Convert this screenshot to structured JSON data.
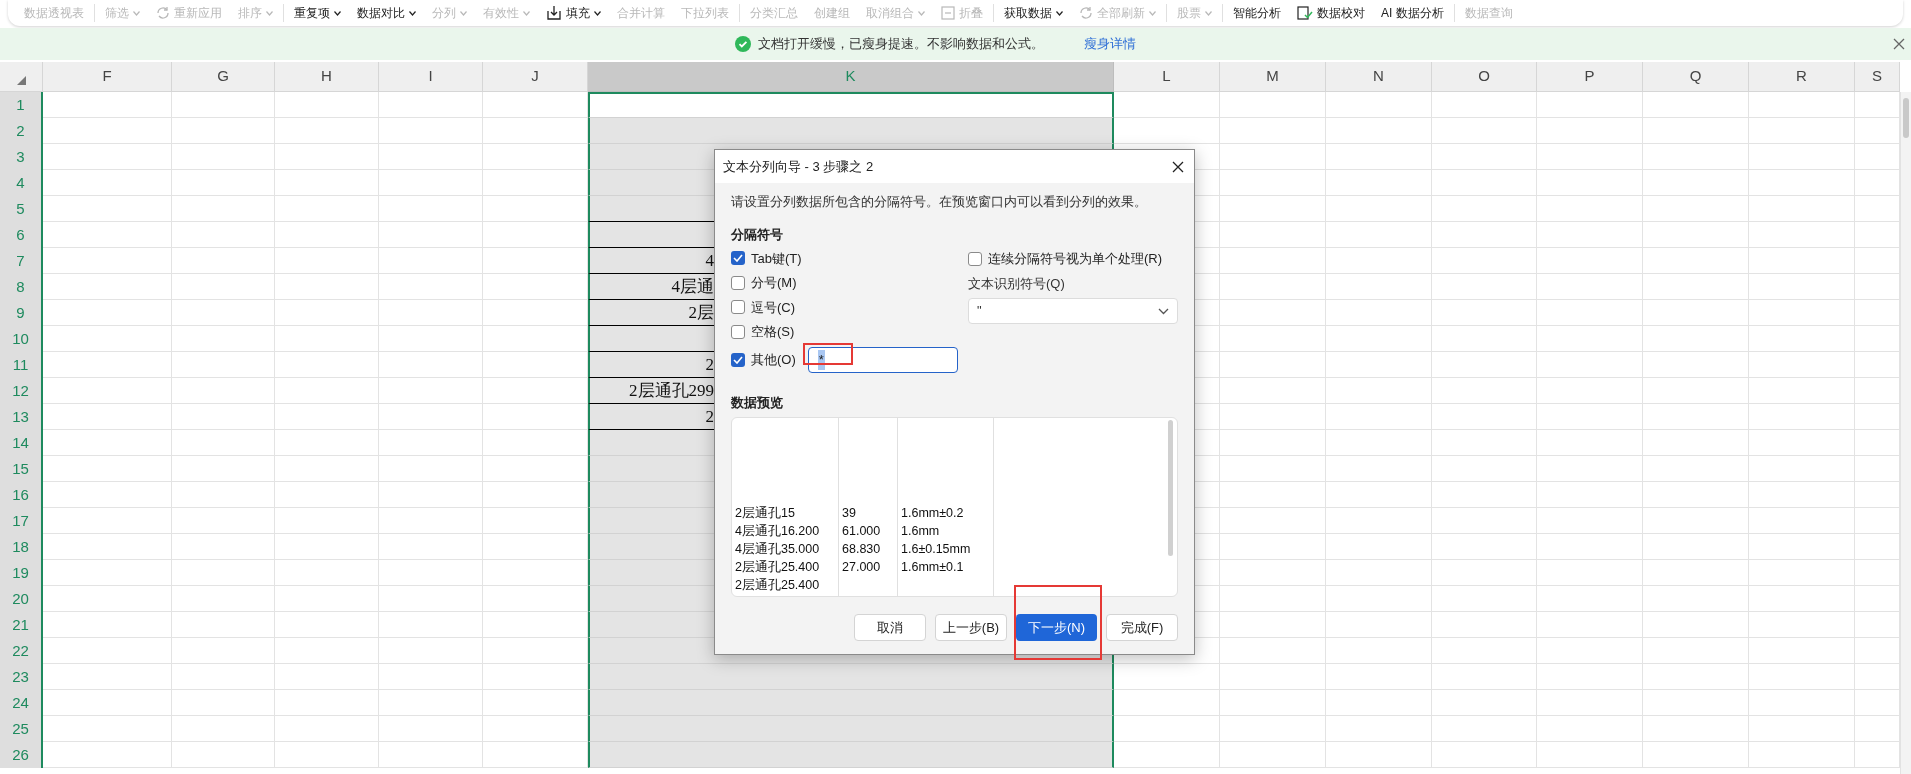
{
  "toolbar": {
    "groups": [
      {
        "items": [
          {
            "label": "数据透视表",
            "disabled": true,
            "dropdown": false
          }
        ]
      },
      {
        "items": [
          {
            "label": "筛选",
            "disabled": true,
            "dropdown": true
          },
          {
            "label": "重新应用",
            "disabled": true,
            "dropdown": false,
            "kind": "refresh"
          },
          {
            "label": "排序",
            "disabled": true,
            "dropdown": true
          }
        ]
      },
      {
        "items": [
          {
            "label": "重复项",
            "disabled": false,
            "dropdown": true
          },
          {
            "label": "数据对比",
            "disabled": false,
            "dropdown": true
          },
          {
            "label": "分列",
            "disabled": true,
            "dropdown": true
          },
          {
            "label": "有效性",
            "disabled": true,
            "dropdown": true
          },
          {
            "label": "填充",
            "disabled": false,
            "dropdown": true,
            "kind": "download"
          },
          {
            "label": "合并计算",
            "disabled": true,
            "dropdown": false
          },
          {
            "label": "下拉列表",
            "disabled": true,
            "dropdown": false
          }
        ]
      },
      {
        "items": [
          {
            "label": "分类汇总",
            "disabled": true,
            "dropdown": false
          },
          {
            "label": "创建组",
            "disabled": true,
            "dropdown": false
          },
          {
            "label": "取消组合",
            "disabled": true,
            "dropdown": true
          },
          {
            "label": "折叠",
            "disabled": true,
            "dropdown": false,
            "kind": "collapse"
          }
        ]
      },
      {
        "items": [
          {
            "label": "获取数据",
            "disabled": false,
            "dropdown": true
          },
          {
            "label": "全部刷新",
            "disabled": true,
            "dropdown": true,
            "kind": "refresh"
          }
        ]
      },
      {
        "items": [
          {
            "label": "股票",
            "disabled": true,
            "dropdown": true
          }
        ]
      },
      {
        "items": [
          {
            "label": "智能分析",
            "disabled": false,
            "dropdown": false
          },
          {
            "label": "数据校对",
            "disabled": false,
            "dropdown": false,
            "kind": "check"
          },
          {
            "label": "AI 数据分析",
            "disabled": false,
            "dropdown": false
          }
        ]
      },
      {
        "items": [
          {
            "label": "数据查询",
            "disabled": true,
            "dropdown": false
          }
        ]
      }
    ]
  },
  "notice": {
    "message": "文档打开缓慢，已瘦身提速。不影响数据和公式。",
    "link": "瘦身详情"
  },
  "sheet": {
    "columns": [
      {
        "label": "F",
        "selected": false
      },
      {
        "label": "G",
        "selected": false
      },
      {
        "label": "H",
        "selected": false
      },
      {
        "label": "I",
        "selected": false
      },
      {
        "label": "J",
        "selected": false
      },
      {
        "label": "K",
        "selected": true
      },
      {
        "label": "L",
        "selected": false
      },
      {
        "label": "M",
        "selected": false
      },
      {
        "label": "N",
        "selected": false
      },
      {
        "label": "O",
        "selected": false
      },
      {
        "label": "P",
        "selected": false
      },
      {
        "label": "Q",
        "selected": false
      },
      {
        "label": "R",
        "selected": false
      },
      {
        "label": "S",
        "selected": false
      }
    ],
    "rows": [
      {
        "label": "1",
        "active": true,
        "border_bottom": false
      },
      {
        "label": "2",
        "active": false,
        "border_bottom": false
      },
      {
        "label": "3",
        "active": false,
        "border_bottom": false
      },
      {
        "label": "4",
        "active": false,
        "border_bottom": false
      },
      {
        "label": "5",
        "active": false,
        "border_bottom": true
      },
      {
        "label": "6",
        "active": false,
        "border_bottom": true
      },
      {
        "label": "7",
        "active": false,
        "border_bottom": true,
        "k_text": "4"
      },
      {
        "label": "8",
        "active": false,
        "border_bottom": true,
        "k_text": "4层通"
      },
      {
        "label": "9",
        "active": false,
        "border_bottom": true,
        "k_text": "2层"
      },
      {
        "label": "10",
        "active": false,
        "border_bottom": true
      },
      {
        "label": "11",
        "active": false,
        "border_bottom": true,
        "k_text": "2"
      },
      {
        "label": "12",
        "active": false,
        "border_bottom": true,
        "k_text": "2层通孔299"
      },
      {
        "label": "13",
        "active": false,
        "border_bottom": true,
        "k_text": "2"
      },
      {
        "label": "14",
        "active": false,
        "border_bottom": false
      },
      {
        "label": "15",
        "active": false,
        "border_bottom": false
      },
      {
        "label": "16",
        "active": false,
        "border_bottom": false
      },
      {
        "label": "17",
        "active": false,
        "border_bottom": false
      },
      {
        "label": "18",
        "active": false,
        "border_bottom": false
      },
      {
        "label": "19",
        "active": false,
        "border_bottom": false
      },
      {
        "label": "20",
        "active": false,
        "border_bottom": false
      },
      {
        "label": "21",
        "active": false,
        "border_bottom": false
      },
      {
        "label": "22",
        "active": false,
        "border_bottom": false
      },
      {
        "label": "23",
        "active": false,
        "border_bottom": false
      },
      {
        "label": "24",
        "active": false,
        "border_bottom": false
      },
      {
        "label": "25",
        "active": false,
        "border_bottom": false
      },
      {
        "label": "26",
        "active": false,
        "border_bottom": false
      }
    ]
  },
  "dialog": {
    "title": "文本分列向导 - 3 步骤之 2",
    "instruction": "请设置分列数据所包含的分隔符号。在预览窗口内可以看到分列的效果。",
    "delimiters_heading": "分隔符号",
    "delimiters": [
      {
        "label": "Tab键(T)",
        "checked": true
      },
      {
        "label": "分号(M)",
        "checked": false
      },
      {
        "label": "逗号(C)",
        "checked": false
      },
      {
        "label": "空格(S)",
        "checked": false
      },
      {
        "label": "其他(O)",
        "checked": true
      }
    ],
    "other_field": {
      "value": "*",
      "highlighted": true
    },
    "consecutive": {
      "label": "连续分隔符号视为单个处理(R)",
      "checked": false
    },
    "qualifier": {
      "label": "文本识别符号(Q)",
      "value": "\""
    },
    "preview_heading": "数据预览",
    "preview_rows": [
      {
        "cells": [
          "2层通孔15",
          "39",
          "1.6mm±0.2"
        ]
      },
      {
        "cells": [
          "4层通孔16.200",
          "61.000",
          "1.6mm"
        ]
      },
      {
        "cells": [
          "4层通孔35.000",
          "68.830",
          "1.6±0.15mm"
        ]
      },
      {
        "cells": [
          "2层通孔25.400",
          "27.000",
          "1.6mm±0.1"
        ]
      },
      {
        "cells": [
          "2层通孔25.400"
        ]
      }
    ],
    "buttons": [
      {
        "label": "取消",
        "primary": false,
        "highlighted": false
      },
      {
        "label": "上一步(B)",
        "primary": false,
        "highlighted": false
      },
      {
        "label": "下一步(N)",
        "primary": true,
        "highlighted": true
      },
      {
        "label": "完成(F)",
        "primary": false,
        "highlighted": false
      }
    ]
  }
}
